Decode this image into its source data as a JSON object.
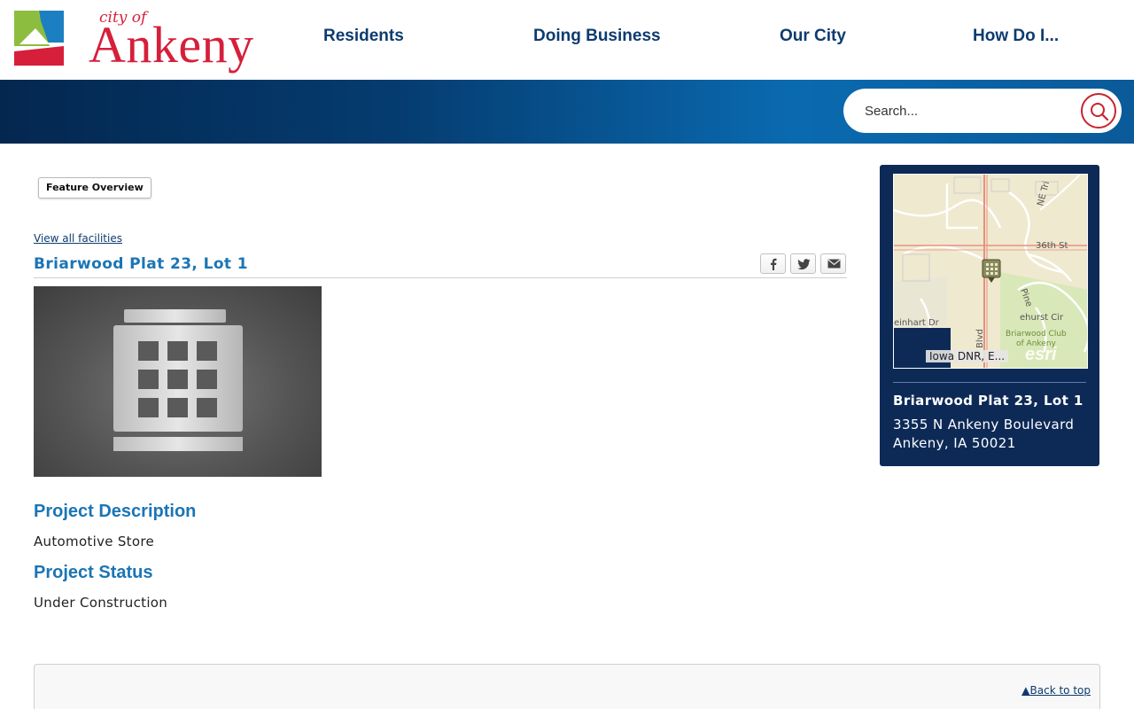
{
  "logo": {
    "small_text": "city of",
    "big_text": "Ankeny"
  },
  "nav": {
    "items": [
      {
        "label": "Residents"
      },
      {
        "label": "Doing Business"
      },
      {
        "label": "Our City"
      },
      {
        "label": "How Do I..."
      }
    ]
  },
  "search": {
    "placeholder": "Search..."
  },
  "tabs": {
    "feature_overview": "Feature Overview"
  },
  "links": {
    "view_all": "View all facilities",
    "back_to_top": "Back to top",
    "back_to_top_icon": "▲"
  },
  "facility": {
    "title": "Briarwood Plat 23, Lot 1",
    "description_heading": "Project Description",
    "description": "Automotive Store",
    "status_heading": "Project Status",
    "status": "Under Construction"
  },
  "share": {
    "icons": [
      "facebook-icon",
      "twitter-icon",
      "email-icon"
    ]
  },
  "map_card": {
    "title": "Briarwood Plat 23, Lot 1",
    "address_line1": "3355 N Ankeny Boulevard",
    "address_line2": "Ankeny, IA 50021",
    "attribution": "Iowa DNR, E...",
    "brand": "esri",
    "labels": {
      "street_36th": "36th St",
      "ne_trilein": "NE Tri",
      "reinhart": "einhart Dr",
      "blvd": "Blvd",
      "pine": "Pine",
      "hurst": "ehurst Cir",
      "club1": "Briarwood Club",
      "club2": "of Ankeny"
    }
  },
  "colors": {
    "brand_red": "#d61f3a",
    "navy": "#0d3b6f",
    "link_blue": "#1b75b5",
    "card_bg": "#0d2a57"
  }
}
